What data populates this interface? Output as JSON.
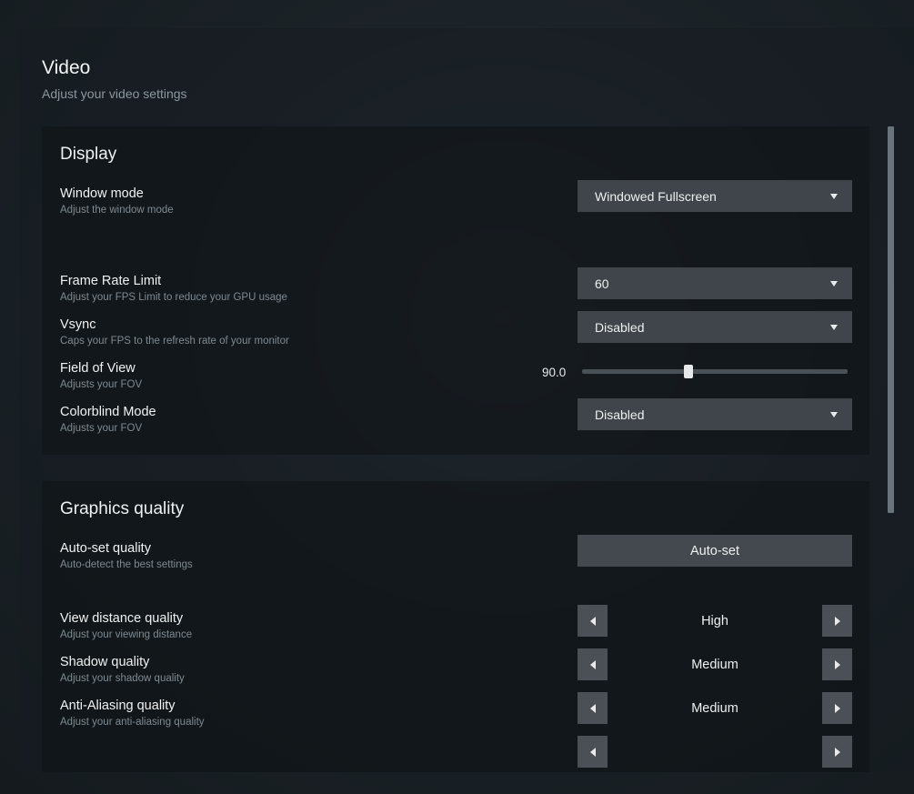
{
  "header": {
    "title": "Video",
    "subtitle": "Adjust your video settings"
  },
  "display": {
    "title": "Display",
    "window_mode": {
      "label": "Window mode",
      "desc": "Adjust the window mode",
      "value": "Windowed Fullscreen"
    },
    "frame_rate": {
      "label": "Frame Rate Limit",
      "desc": "Adjust your FPS Limit to reduce your GPU usage",
      "value": "60"
    },
    "vsync": {
      "label": "Vsync",
      "desc": "Caps your FPS to the refresh rate of your monitor",
      "value": "Disabled"
    },
    "fov": {
      "label": "Field of View",
      "desc": "Adjusts your FOV",
      "value": "90.0",
      "slider_fraction": 0.4
    },
    "colorblind": {
      "label": "Colorblind Mode",
      "desc": "Adjusts your FOV",
      "value": "Disabled"
    }
  },
  "graphics": {
    "title": "Graphics quality",
    "auto_set": {
      "label": "Auto-set quality",
      "desc": "Auto-detect the best settings",
      "button": "Auto-set"
    },
    "view_distance": {
      "label": "View distance quality",
      "desc": "Adjust your viewing distance",
      "value": "High"
    },
    "shadow": {
      "label": "Shadow quality",
      "desc": "Adjust your shadow quality",
      "value": "Medium"
    },
    "anti_aliasing": {
      "label": "Anti-Aliasing quality",
      "desc": "Adjust your anti-aliasing quality",
      "value": "Medium"
    }
  },
  "icons": {
    "dropdown": "caret-down-icon",
    "prev": "arrow-left-icon",
    "next": "arrow-right-icon"
  }
}
